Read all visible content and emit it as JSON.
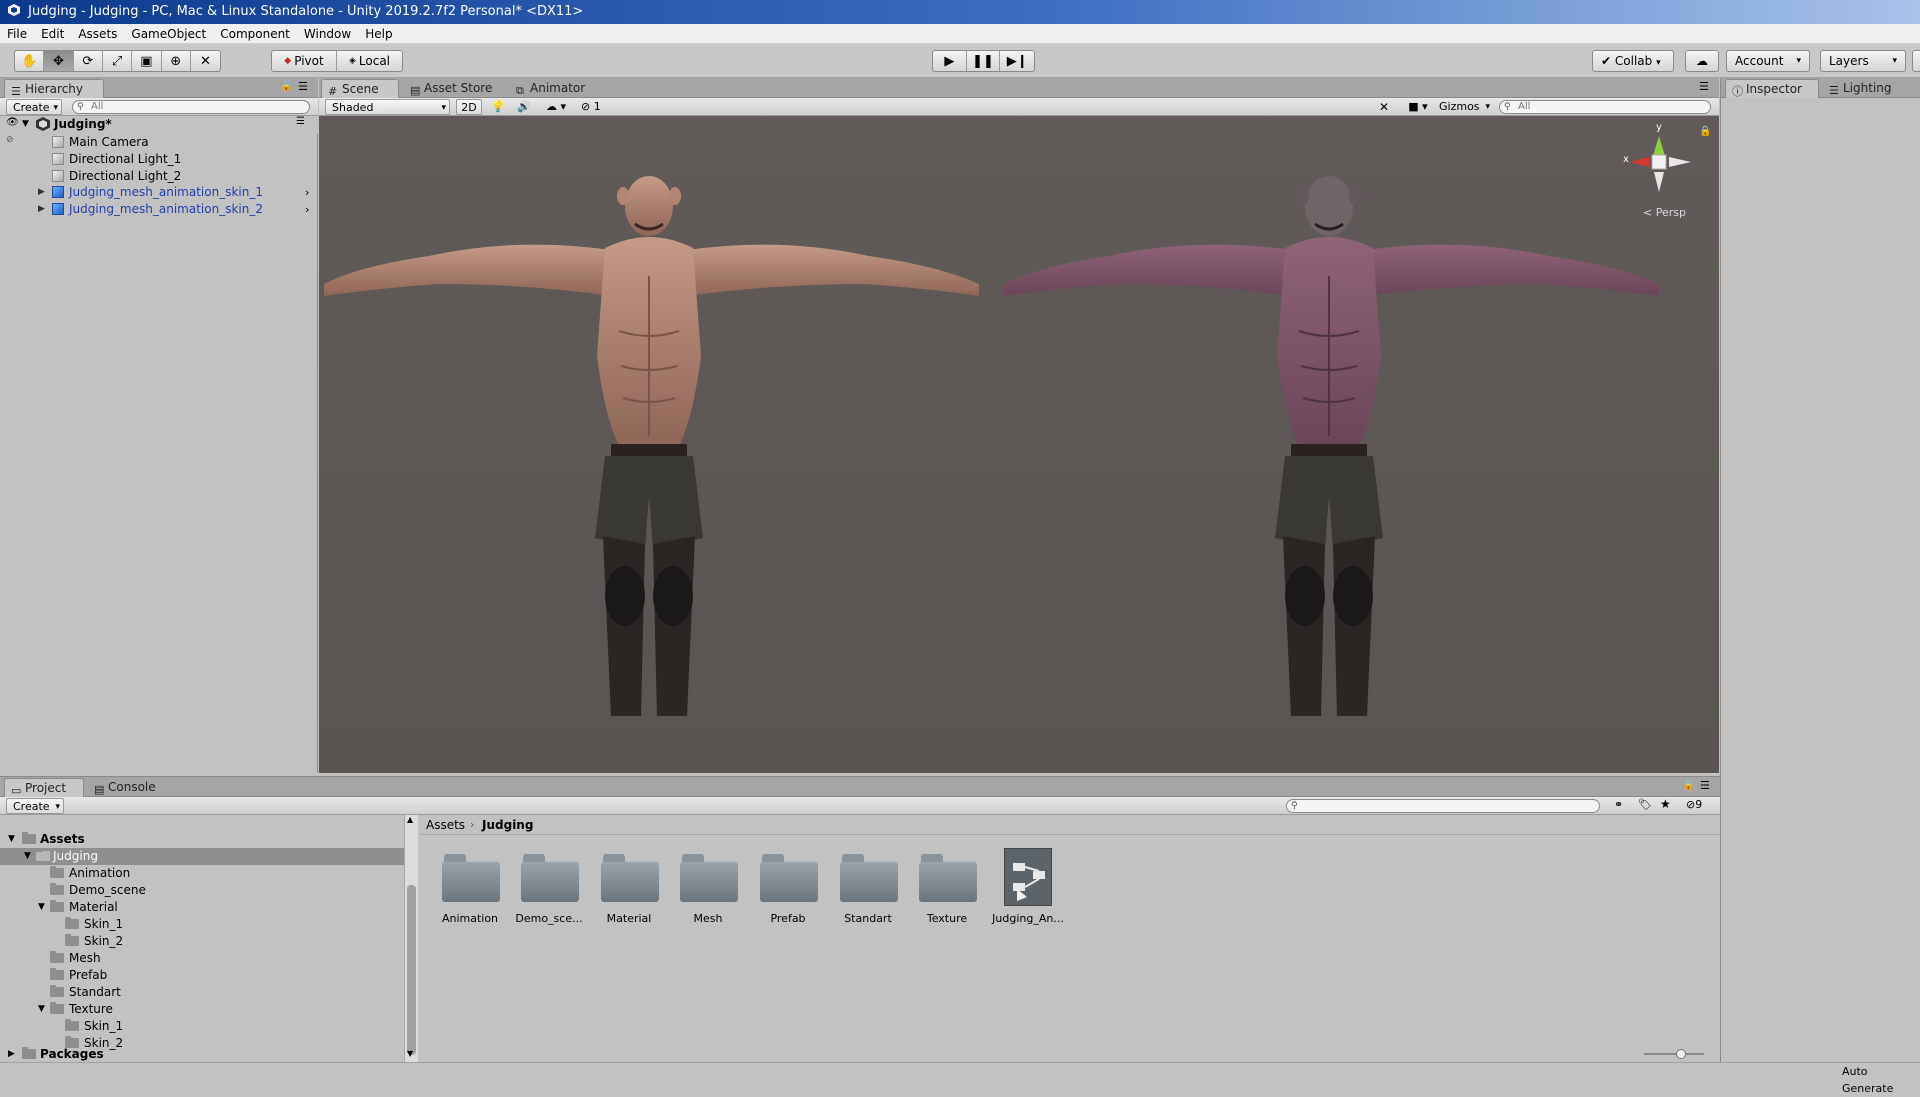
{
  "window": {
    "title": "Judging - Judging - PC, Mac & Linux Standalone - Unity 2019.2.7f2 Personal* <DX11>"
  },
  "menu": [
    "File",
    "Edit",
    "Assets",
    "GameObject",
    "Component",
    "Window",
    "Help"
  ],
  "toolbar": {
    "pivot_label": "Pivot",
    "local_label": "Local",
    "collab_label": "Collab",
    "account_label": "Account",
    "layers_label": "Layers"
  },
  "hierarchy": {
    "tab_label": "Hierarchy",
    "create_label": "Create",
    "search_placeholder": "All",
    "scene_name": "Judging*",
    "items": [
      {
        "label": "Main Camera"
      },
      {
        "label": "Directional Light_1"
      },
      {
        "label": "Directional Light_2"
      },
      {
        "label": "Judging_mesh_animation_skin_1"
      },
      {
        "label": "Judging_mesh_animation_skin_2"
      }
    ]
  },
  "scene_tabs": [
    "Scene",
    "Asset Store",
    "Animator"
  ],
  "scene_toolbar": {
    "shading_mode": "Shaded",
    "mode_2d": "2D",
    "hidden_count": "1",
    "gizmos_label": "Gizmos",
    "search_placeholder": "All"
  },
  "scene_gizmo": {
    "y_axis": "y",
    "x_axis": "x",
    "projection": "Persp"
  },
  "right_tabs": [
    "Inspector",
    "Lighting"
  ],
  "project": {
    "tab_project": "Project",
    "tab_console": "Console",
    "create_label": "Create",
    "hidden_count": "9",
    "breadcrumb_root": "Assets",
    "breadcrumb_current": "Judging",
    "tree": [
      {
        "label": "Assets",
        "bold": true
      },
      {
        "label": "Judging"
      },
      {
        "label": "Animation"
      },
      {
        "label": "Demo_scene"
      },
      {
        "label": "Material"
      },
      {
        "label": "Skin_1"
      },
      {
        "label": "Skin_2"
      },
      {
        "label": "Mesh"
      },
      {
        "label": "Prefab"
      },
      {
        "label": "Standart"
      },
      {
        "label": "Texture"
      },
      {
        "label": "Skin_1"
      },
      {
        "label": "Skin_2"
      },
      {
        "label": "Packages",
        "bold": true
      }
    ],
    "assets": [
      {
        "label": "Animation"
      },
      {
        "label": "Demo_sce..."
      },
      {
        "label": "Material"
      },
      {
        "label": "Mesh"
      },
      {
        "label": "Prefab"
      },
      {
        "label": "Standart"
      },
      {
        "label": "Texture"
      },
      {
        "label": "Judging_An..."
      }
    ]
  },
  "status": {
    "right_text": "Auto Generate"
  },
  "colors": {
    "title_bar": "#0b3a8c",
    "scene_background": "#5f5a56",
    "selection": "#3d6bc4",
    "prefab_text": "#1f3fa8",
    "skin_1_tone": "#b48a7a",
    "skin_2_tone": "#8a5a70"
  }
}
